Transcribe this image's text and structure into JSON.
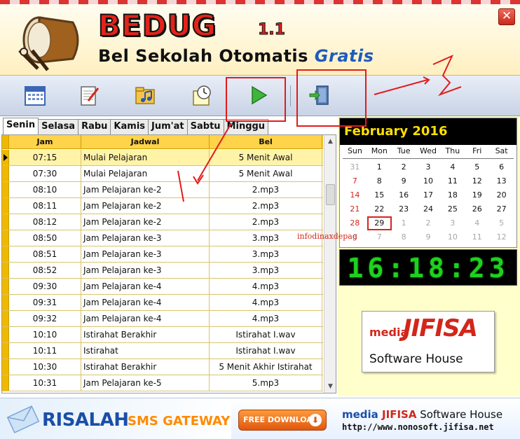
{
  "header": {
    "app_name": "BEDUG",
    "version": "1.1",
    "tagline_main": "Bel Sekolah Otomatis ",
    "tagline_accent": "Gratis",
    "close_label": "✕"
  },
  "toolbar": {
    "buttons": [
      {
        "icon": "calendar-icon"
      },
      {
        "icon": "notepad-icon"
      },
      {
        "icon": "music-folder-icon"
      },
      {
        "icon": "clock-note-icon"
      },
      {
        "icon": "play-icon"
      },
      {
        "icon": "exit-door-icon"
      }
    ]
  },
  "tabs": [
    "Senin",
    "Selasa",
    "Rabu",
    "Kamis",
    "Jum'at",
    "Sabtu",
    "Minggu"
  ],
  "grid": {
    "headers": [
      "Jam",
      "Jadwal",
      "Bel"
    ],
    "rows": [
      {
        "jam": "07:15",
        "jadwal": "Mulai Pelajaran",
        "bel": "5 Menit Awal"
      },
      {
        "jam": "07:30",
        "jadwal": "Mulai Pelajaran",
        "bel": "5 Menit Awal"
      },
      {
        "jam": "08:10",
        "jadwal": "Jam Pelajaran ke-2",
        "bel": "2.mp3"
      },
      {
        "jam": "08:11",
        "jadwal": "Jam Pelajaran ke-2",
        "bel": "2.mp3"
      },
      {
        "jam": "08:12",
        "jadwal": "Jam Pelajaran ke-2",
        "bel": "2.mp3"
      },
      {
        "jam": "08:50",
        "jadwal": "Jam Pelajaran ke-3",
        "bel": "3.mp3"
      },
      {
        "jam": "08:51",
        "jadwal": "Jam Pelajaran ke-3",
        "bel": "3.mp3"
      },
      {
        "jam": "08:52",
        "jadwal": "Jam Pelajaran ke-3",
        "bel": "3.mp3"
      },
      {
        "jam": "09:30",
        "jadwal": "Jam Pelajaran ke-4",
        "bel": "4.mp3"
      },
      {
        "jam": "09:31",
        "jadwal": "Jam Pelajaran ke-4",
        "bel": "4.mp3"
      },
      {
        "jam": "09:32",
        "jadwal": "Jam Pelajaran ke-4",
        "bel": "4.mp3"
      },
      {
        "jam": "10:10",
        "jadwal": "Istirahat Berakhir",
        "bel": "Istirahat I.wav"
      },
      {
        "jam": "10:11",
        "jadwal": "Istirahat",
        "bel": "Istirahat I.wav"
      },
      {
        "jam": "10:30",
        "jadwal": "Istirahat Berakhir",
        "bel": "5 Menit Akhir Istirahat"
      },
      {
        "jam": "10:31",
        "jadwal": "Jam Pelajaran ke-5",
        "bel": "5.mp3"
      }
    ]
  },
  "calendar": {
    "title": "February 2016",
    "dow": [
      "Sun",
      "Mon",
      "Tue",
      "Wed",
      "Thu",
      "Fri",
      "Sat"
    ],
    "weeks": [
      [
        "31",
        "1",
        "2",
        "3",
        "4",
        "5",
        "6"
      ],
      [
        "7",
        "8",
        "9",
        "10",
        "11",
        "12",
        "13"
      ],
      [
        "14",
        "15",
        "16",
        "17",
        "18",
        "19",
        "20"
      ],
      [
        "21",
        "22",
        "23",
        "24",
        "25",
        "26",
        "27"
      ],
      [
        "28",
        "29",
        "1",
        "2",
        "3",
        "4",
        "5"
      ],
      [
        "6",
        "7",
        "8",
        "9",
        "10",
        "11",
        "12"
      ]
    ],
    "today": "29",
    "colors": {
      "sunday": "#d3261b",
      "other_month": "#a8a8a8",
      "title_text": "#ffe000"
    }
  },
  "clock": {
    "time": "16:18:23"
  },
  "watermark": "infodinaxdepag",
  "logo": {
    "media": "media",
    "name": "JIFISA",
    "subtitle": "Software House"
  },
  "footer": {
    "risalah": "RISALAH",
    "sms": "SMS GATEWAY",
    "download_label": "FREE DOWNLOAD",
    "brand_media": "media ",
    "brand_name": "JIFISA",
    "brand_rest": " Software House",
    "url": "http://www.nonosoft.jifisa.net"
  }
}
